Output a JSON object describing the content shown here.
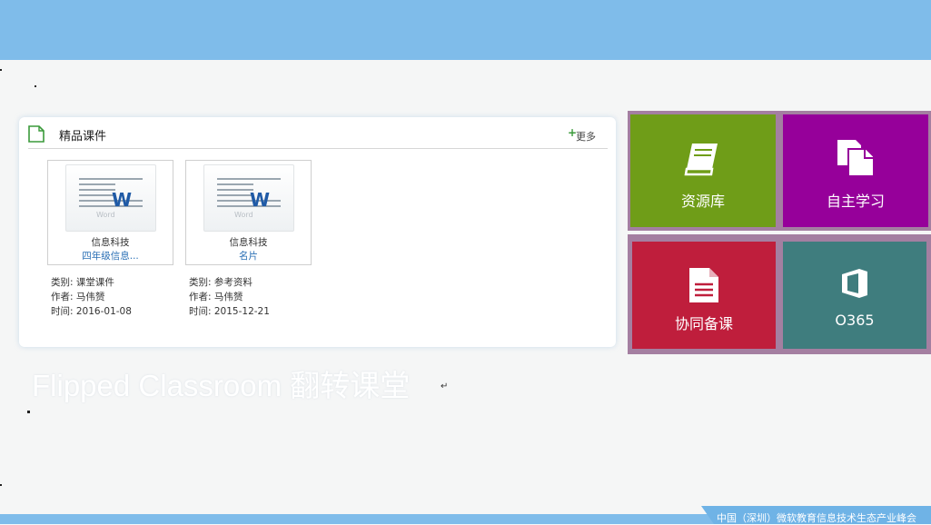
{
  "courseware": {
    "title": "精品课件",
    "more_label": "更多",
    "items": [
      {
        "word_logo": "W",
        "word_label": "Word",
        "subject": "信息科技",
        "name": "四年级信息...",
        "category": "类别: 课堂课件",
        "author": "作者: 马伟赟",
        "time": "时间: 2016-01-08"
      },
      {
        "word_logo": "W",
        "word_label": "Word",
        "subject": "信息科技",
        "name": "名片",
        "category": "类别: 参考资料",
        "author": "作者: 马伟赟",
        "time": "时间: 2015-12-21"
      }
    ]
  },
  "tiles": [
    {
      "label": "资源库",
      "color": "#6f9d18",
      "icon": "book-icon"
    },
    {
      "label": "自主学习",
      "color": "#96009a",
      "icon": "copy-icon"
    },
    {
      "label": "协同备课",
      "color": "#bf1e3c",
      "icon": "document-icon"
    },
    {
      "label": "O365",
      "color": "#3f7d7e",
      "icon": "office-icon"
    }
  ],
  "slide": {
    "caption": "Flipped Classroom 翻转课堂",
    "return_mark": "↵"
  },
  "footer": {
    "text": "中国（深圳）微软教育信息技术生态产业峰会"
  },
  "colors": {
    "banner": "#7fbcea",
    "frame": "#a47fa1"
  }
}
